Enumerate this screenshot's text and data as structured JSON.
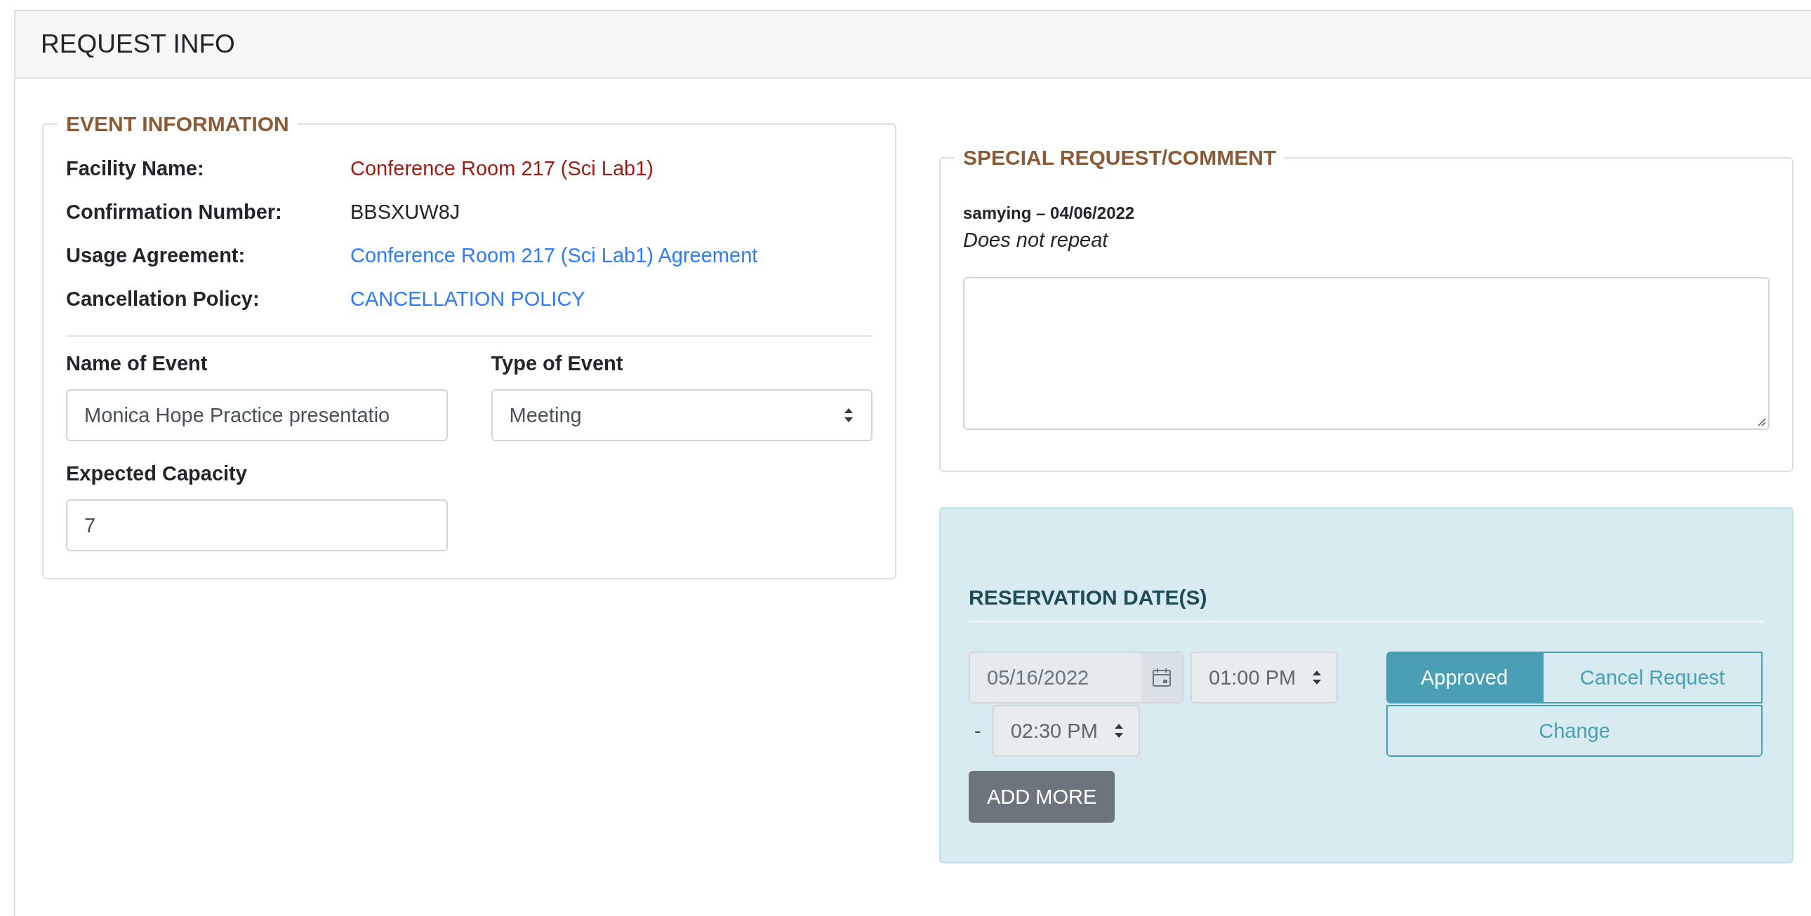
{
  "card": {
    "title": "REQUEST INFO"
  },
  "event_information": {
    "legend": "EVENT INFORMATION",
    "details": [
      {
        "label": "Facility Name:",
        "value": "Conference Room 217 (Sci Lab1)",
        "kind": "highlight"
      },
      {
        "label": "Confirmation Number:",
        "value": "BBSXUW8J",
        "kind": "plain"
      },
      {
        "label": "Usage Agreement:",
        "value": "Conference Room 217 (Sci Lab1) Agreement",
        "kind": "link"
      },
      {
        "label": "Cancellation Policy:",
        "value": "CANCELLATION POLICY",
        "kind": "link"
      }
    ],
    "fields": [
      {
        "label": "Name of Event",
        "value": "Monica Hope Practice presentatio",
        "kind": "text"
      },
      {
        "label": "Type of Event",
        "value": "Meeting",
        "kind": "select"
      },
      {
        "label": "Expected Capacity",
        "value": "7",
        "kind": "text"
      }
    ]
  },
  "special_request": {
    "legend": "SPECIAL REQUEST/COMMENT",
    "author": "samying – 04/06/2022",
    "comment": "Does not repeat"
  },
  "reservation": {
    "title": "RESERVATION DATE(S)",
    "dates": [
      {
        "date": "05/16/2022",
        "start": "01:00 PM",
        "separator": "-",
        "end": "02:30 PM",
        "disabled": true,
        "status_buttons": [
          {
            "label": "Approved",
            "selected": true
          },
          {
            "label": "Cancel Request",
            "selected": false
          }
        ],
        "change_button": "Change"
      }
    ],
    "add_button": "ADD MORE"
  }
}
